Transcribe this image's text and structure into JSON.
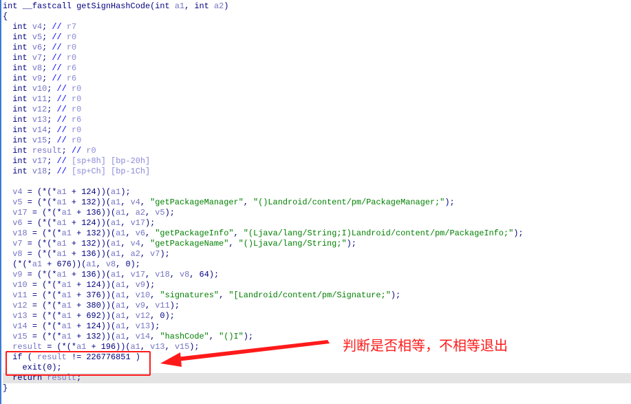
{
  "code": {
    "lines": [
      "int __fastcall getSignHashCode(int a1, int a2)",
      "{",
      "  int v4; // r7",
      "  int v5; // r0",
      "  int v6; // r0",
      "  int v7; // r0",
      "  int v8; // r6",
      "  int v9; // r6",
      "  int v10; // r0",
      "  int v11; // r0",
      "  int v12; // r0",
      "  int v13; // r6",
      "  int v14; // r0",
      "  int v15; // r0",
      "  int result; // r0",
      "  int v17; // [sp+8h] [bp-20h]",
      "  int v18; // [sp+Ch] [bp-1Ch]",
      "",
      "  v4 = (*(*a1 + 124))(a1);",
      "  v5 = (*(*a1 + 132))(a1, v4, \"getPackageManager\", \"()Landroid/content/pm/PackageManager;\");",
      "  v17 = (*(*a1 + 136))(a1, a2, v5);",
      "  v6 = (*(*a1 + 124))(a1, v17);",
      "  v18 = (*(*a1 + 132))(a1, v6, \"getPackageInfo\", \"(Ljava/lang/String;I)Landroid/content/pm/PackageInfo;\");",
      "  v7 = (*(*a1 + 132))(a1, v4, \"getPackageName\", \"()Ljava/lang/String;\");",
      "  v8 = (*(*a1 + 136))(a1, a2, v7);",
      "  (*(*a1 + 676))(a1, v8, 0);",
      "  v9 = (*(*a1 + 136))(a1, v17, v18, v8, 64);",
      "  v10 = (*(*a1 + 124))(a1, v9);",
      "  v11 = (*(*a1 + 376))(a1, v10, \"signatures\", \"[Landroid/content/pm/Signature;\");",
      "  v12 = (*(*a1 + 380))(a1, v9, v11);",
      "  v13 = (*(*a1 + 692))(a1, v12, 0);",
      "  v14 = (*(*a1 + 124))(a1, v13);",
      "  v15 = (*(*a1 + 132))(a1, v14, \"hashCode\", \"()I\");",
      "  result = (*(*a1 + 196))(a1, v13, v15);",
      "  if ( result != 226776851 )",
      "    exit(0);",
      "  return result;",
      "}"
    ],
    "highlighted_line": 36
  },
  "annotation": {
    "note": "判断是否相等，不相等退出",
    "color": "#ff1a1a"
  },
  "colors": {
    "keyword": "#000080",
    "variable": "#7474c4",
    "string": "#008000",
    "comment": "#0000ff"
  }
}
